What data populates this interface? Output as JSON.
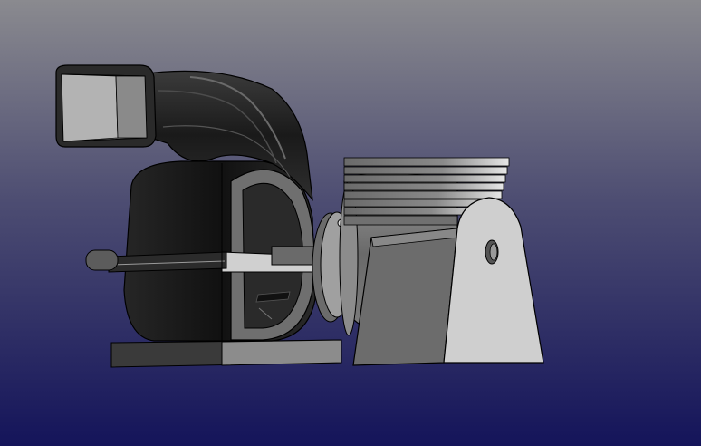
{
  "scene": {
    "subject": "",
    "colors": {
      "background_top": "#87878d",
      "background_bottom": "#16165a",
      "dark_body": "#1f1f1f",
      "mid_gray": "#6e6e6e",
      "light_gray": "#c9c9c9",
      "outline": "#000000"
    },
    "icons": [
      "blower-housing",
      "outlet-duct",
      "motor",
      "cooling-fins",
      "motor-mount-bracket",
      "base-plate",
      "shaft"
    ]
  }
}
